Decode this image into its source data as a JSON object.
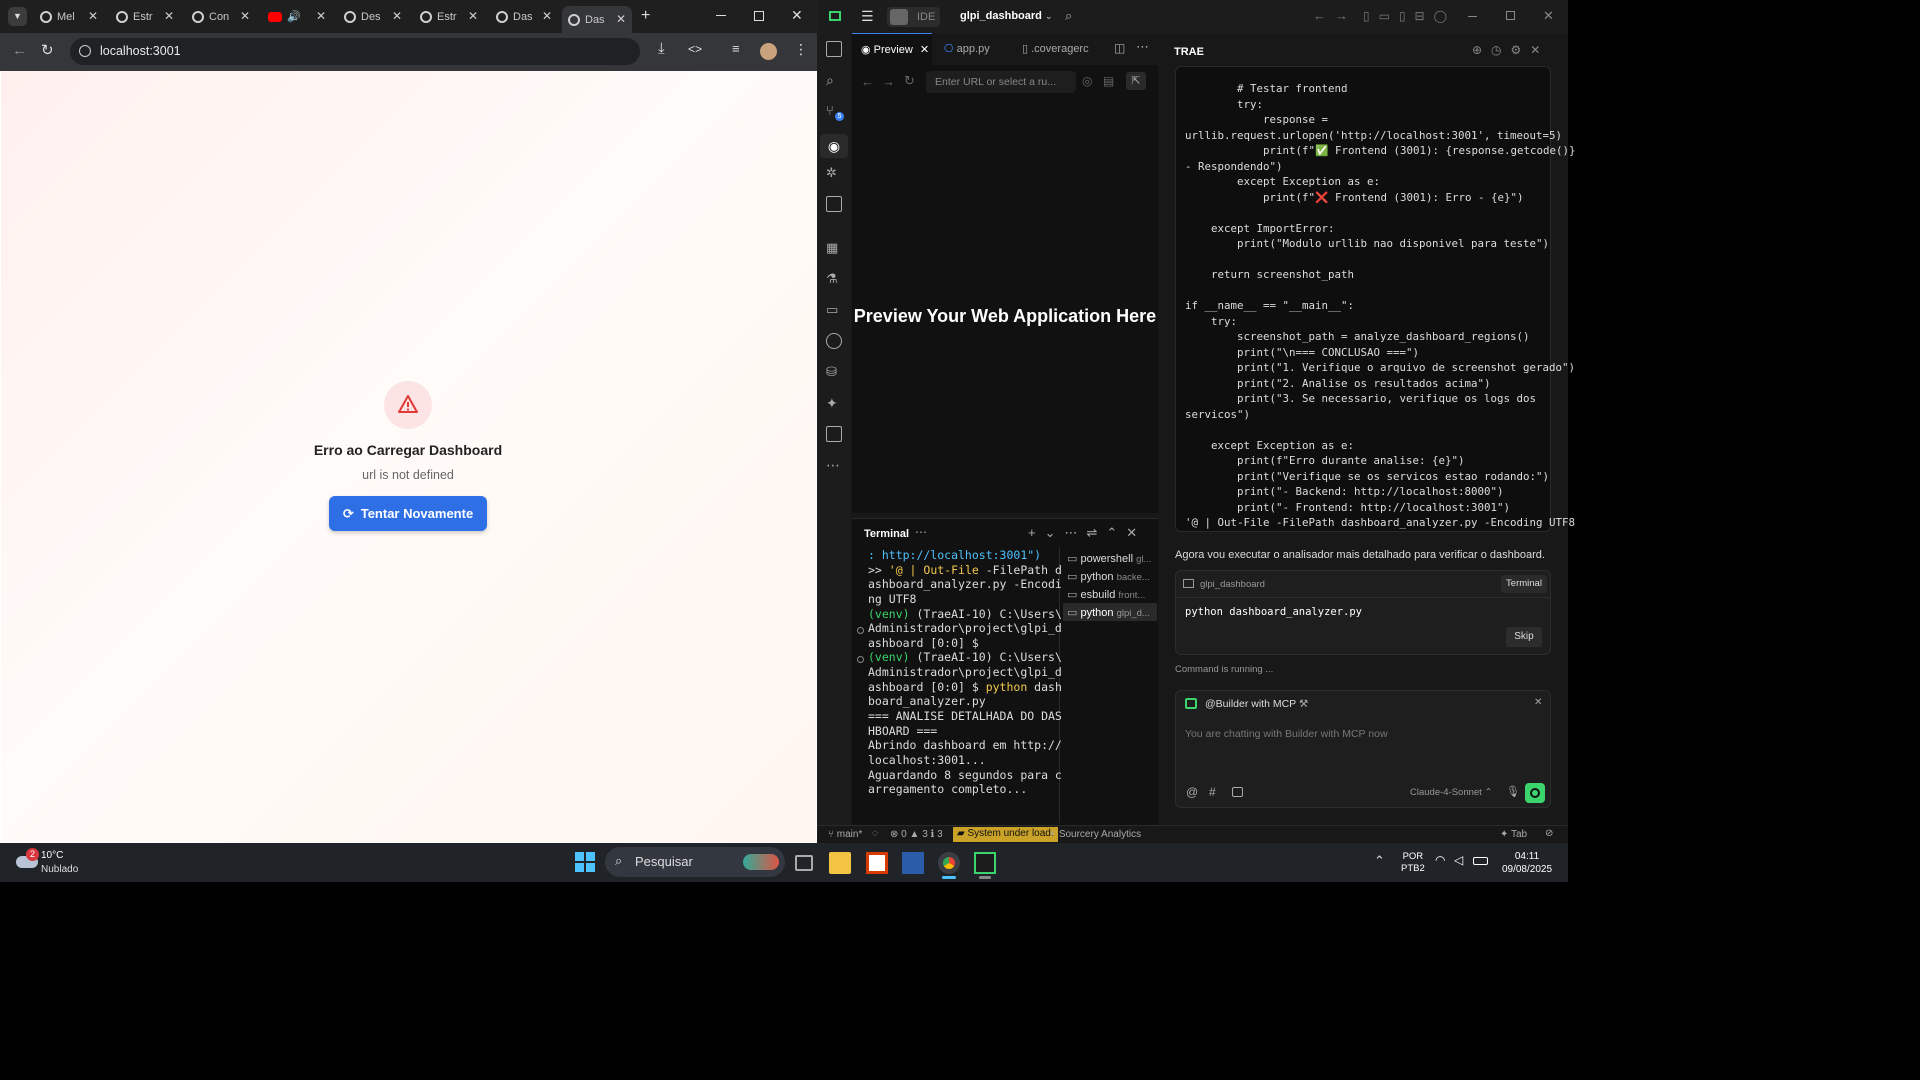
{
  "chrome": {
    "tabs": [
      "Mel",
      "Estr",
      "Con",
      "",
      "Des",
      "Estr",
      "Das",
      "Das"
    ],
    "url": "localhost:3001"
  },
  "page": {
    "error_title": "Erro ao Carregar Dashboard",
    "error_message": "url is not defined",
    "retry_label": "Tentar Novamente"
  },
  "trae": {
    "ide_label": "IDE",
    "project": "glpi_dashboard",
    "editor_tabs": [
      "Preview",
      "app.py",
      ".coveragerc"
    ],
    "url_placeholder": "Enter URL or select a ru...",
    "preview_text": "Preview Your Web Application Here",
    "panel_title": "TRAE",
    "code_lines": [
      "        # Testar frontend",
      "        try:",
      "            response =",
      "urllib.request.urlopen('http://localhost:3001', timeout=5)",
      "            print(f\"✅ Frontend (3001): {response.getcode()}",
      "- Respondendo\")",
      "        except Exception as e:",
      "            print(f\"❌ Frontend (3001): Erro - {e}\")",
      "",
      "    except ImportError:",
      "        print(\"Modulo urllib nao disponivel para teste\")",
      "",
      "    return screenshot_path",
      "",
      "if __name__ == \"__main__\":",
      "    try:",
      "        screenshot_path = analyze_dashboard_regions()",
      "        print(\"\\n=== CONCLUSAO ===\")",
      "        print(\"1. Verifique o arquivo de screenshot gerado\")",
      "        print(\"2. Analise os resultados acima\")",
      "        print(\"3. Se necessario, verifique os logs dos",
      "servicos\")",
      "",
      "    except Exception as e:",
      "        print(f\"Erro durante analise: {e}\")",
      "        print(\"Verifique se os servicos estao rodando:\")",
      "        print(\"- Backend: http://localhost:8000\")",
      "        print(\"- Frontend: http://localhost:3001\")",
      "'@ | Out-File -FilePath dashboard_analyzer.py -Encoding UTF8"
    ],
    "chat_message": "Agora vou executar o analisador mais detalhado para verificar o dashboard.",
    "cmd_project": "glpi_dashboard",
    "cmd_terminal_btn": "Terminal",
    "cmd_text": "python dashboard_analyzer.py",
    "skip_label": "Skip",
    "running_text": "Command is running ...",
    "builder_label": "@Builder with MCP",
    "chat_placeholder": "You are chatting with Builder with MCP now",
    "model": "Claude-4-Sonnet",
    "terminal_title": "Terminal",
    "terminal_lines": [
      ": http://localhost:3001\")",
      ">> '@ | Out-File -FilePath d",
      "ashboard_analyzer.py -Encodi",
      "ng UTF8",
      "(venv) (TraeAI-10) C:\\Users\\",
      "Administrador\\project\\glpi_d",
      "ashboard [0:0] $",
      "(venv) (TraeAI-10) C:\\Users\\",
      "Administrador\\project\\glpi_d",
      "ashboard [0:0] $ python dash",
      "board_analyzer.py",
      "=== ANALISE DETALHADA DO DAS",
      "HBOARD ===",
      "Abrindo dashboard em http://",
      "localhost:3001...",
      "Aguardando 8 segundos para c",
      "arregamento completo..."
    ],
    "term_sessions": [
      {
        "name": "powershell",
        "sub": "gl..."
      },
      {
        "name": "python",
        "sub": "backe..."
      },
      {
        "name": "esbuild",
        "sub": "front..."
      },
      {
        "name": "python",
        "sub": "glpi_d..."
      }
    ],
    "status": {
      "branch": "main*",
      "errors": "0",
      "warnings": "3",
      "info": "3",
      "load": "System under load.",
      "sourcery": "Sourcery Analytics",
      "tab": "Tab"
    }
  },
  "taskbar": {
    "weather_badge": "2",
    "temp": "10°C",
    "weather": "Nublado",
    "search": "Pesquisar",
    "lang1": "POR",
    "lang2": "PTB2",
    "time": "04:11",
    "date": "09/08/2025"
  }
}
